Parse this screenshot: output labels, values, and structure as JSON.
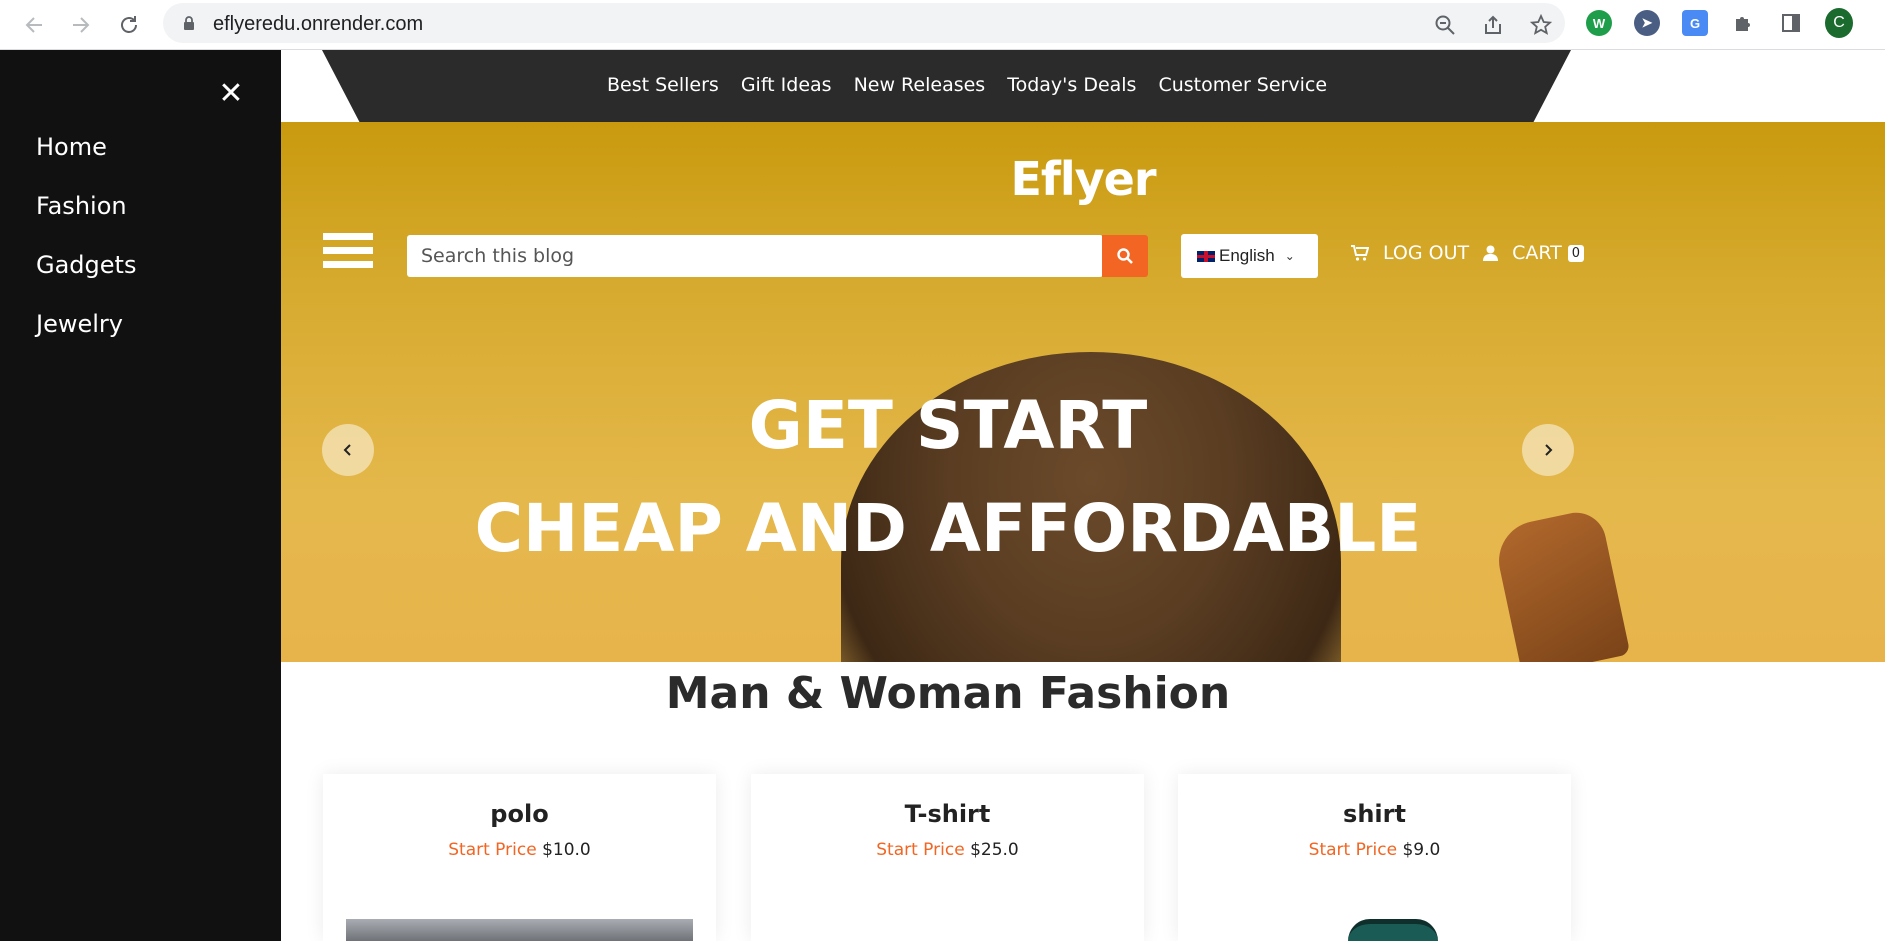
{
  "browser": {
    "url": "eflyeredu.onrender.com",
    "profile_initial": "C"
  },
  "drawer": {
    "close_symbol": "✕",
    "items": [
      {
        "label": "Home"
      },
      {
        "label": "Fashion"
      },
      {
        "label": "Gadgets"
      },
      {
        "label": "Jewelry"
      }
    ]
  },
  "topnav": {
    "links": [
      {
        "label": "Best Sellers"
      },
      {
        "label": "Gift Ideas"
      },
      {
        "label": "New Releases"
      },
      {
        "label": "Today's Deals"
      },
      {
        "label": "Customer Service"
      }
    ]
  },
  "header": {
    "logo": "Eflyer",
    "search_placeholder": "Search this blog",
    "language": "English",
    "logout_label": "LOG OUT",
    "cart_label": "CART",
    "cart_count": "0"
  },
  "hero": {
    "line1": "GET START",
    "line2": "CHEAP AND AFFORDABLE"
  },
  "section": {
    "title": "Man & Woman Fashion",
    "products": [
      {
        "name": "polo",
        "price_label": "Start Price",
        "price": "$10.0"
      },
      {
        "name": "T-shirt",
        "price_label": "Start Price",
        "price": "$25.0"
      },
      {
        "name": "shirt",
        "price_label": "Start Price",
        "price": "$9.0"
      }
    ]
  },
  "colors": {
    "accent": "#f26522",
    "hero_bg": "#d6aa2e",
    "drawer_bg": "#111111",
    "nav_bg": "#2b2b2b"
  }
}
